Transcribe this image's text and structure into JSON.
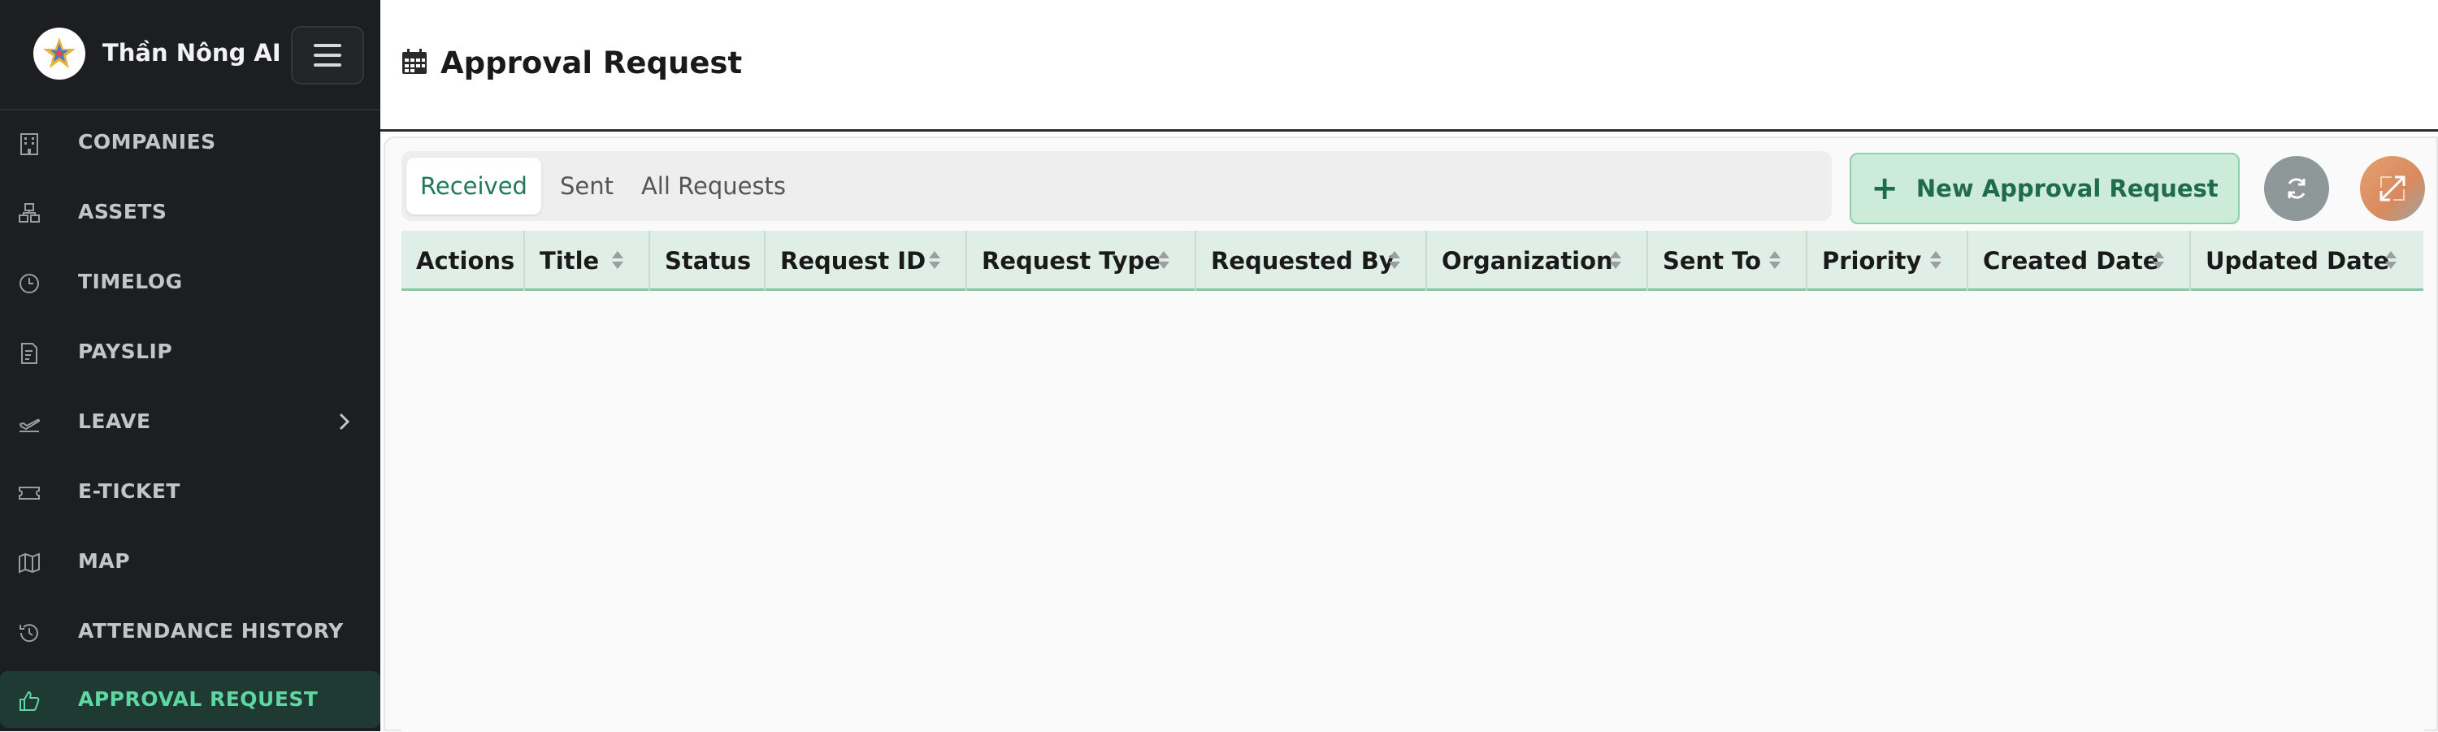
{
  "app": {
    "name": "Thần Nông AI"
  },
  "sidebar": {
    "items": [
      {
        "label": "COMPANIES",
        "icon": "building-icon"
      },
      {
        "label": "ASSETS",
        "icon": "assets-icon"
      },
      {
        "label": "TIMELOG",
        "icon": "clock-icon"
      },
      {
        "label": "PAYSLIP",
        "icon": "payslip-icon"
      },
      {
        "label": "LEAVE",
        "icon": "plane-departure-icon",
        "has_submenu": true
      },
      {
        "label": "E-TICKET",
        "icon": "ticket-icon"
      },
      {
        "label": "MAP",
        "icon": "map-icon"
      },
      {
        "label": "ATTENDANCE HISTORY",
        "icon": "history-icon"
      },
      {
        "label": "APPROVAL REQUEST",
        "icon": "thumbs-up-icon",
        "active": true
      }
    ]
  },
  "header": {
    "title": "Approval Request",
    "icon": "calendar-icon"
  },
  "tabs": [
    {
      "label": "Received",
      "active": true
    },
    {
      "label": "Sent",
      "active": false
    },
    {
      "label": "All Requests",
      "active": false
    }
  ],
  "toolbar": {
    "new_request_label": "New Approval Request",
    "refresh_icon": "refresh-icon",
    "expand_icon": "expand-icon"
  },
  "table": {
    "columns": [
      {
        "label": "Actions",
        "sortable": false
      },
      {
        "label": "Title",
        "sortable": true
      },
      {
        "label": "Status",
        "sortable": false
      },
      {
        "label": "Request ID",
        "sortable": true
      },
      {
        "label": "Request Type",
        "sortable": true
      },
      {
        "label": "Requested By",
        "sortable": true
      },
      {
        "label": "Organization",
        "sortable": true
      },
      {
        "label": "Sent To",
        "sortable": true
      },
      {
        "label": "Priority",
        "sortable": true
      },
      {
        "label": "Created Date",
        "sortable": true
      },
      {
        "label": "Updated Date",
        "sortable": true
      }
    ],
    "rows": []
  },
  "colors": {
    "sidebar_bg": "#1d1e22",
    "accent": "#5fd6a3",
    "button_bg": "#cdebd9",
    "button_text": "#1f6b4a",
    "table_header_bg": "#dfeee6"
  }
}
